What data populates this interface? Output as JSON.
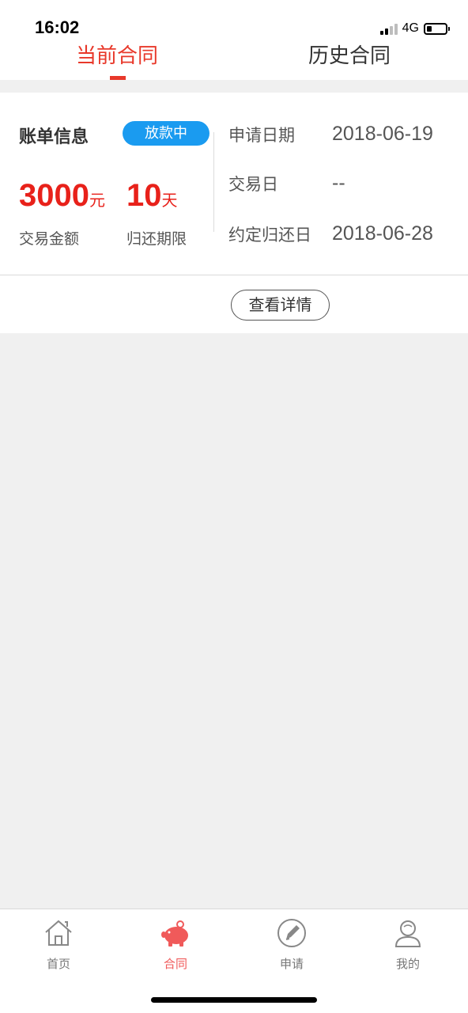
{
  "status_bar": {
    "time": "16:02",
    "network": "4G"
  },
  "tabs": [
    {
      "label": "当前合同",
      "active": true
    },
    {
      "label": "历史合同",
      "active": false
    }
  ],
  "bill": {
    "title": "账单信息",
    "status": "放款中",
    "amount_value": "3000",
    "amount_unit": "元",
    "amount_label": "交易金额",
    "term_value": "10",
    "term_unit": "天",
    "term_label": "归还期限",
    "info": [
      {
        "label": "申请日期",
        "value": "2018-06-19"
      },
      {
        "label": "交易日",
        "value": "--"
      },
      {
        "label": "约定归还日",
        "value": "2018-06-28"
      }
    ],
    "detail_button": "查看详情"
  },
  "bottom_nav": [
    {
      "label": "首页",
      "icon": "home-icon",
      "active": false
    },
    {
      "label": "合同",
      "icon": "piggy-bank-icon",
      "active": true
    },
    {
      "label": "申请",
      "icon": "pencil-icon",
      "active": false
    },
    {
      "label": "我的",
      "icon": "user-icon",
      "active": false
    }
  ],
  "colors": {
    "accent_red": "#e8382a",
    "badge_blue": "#1a9bf0",
    "nav_active": "#f05a5a"
  }
}
